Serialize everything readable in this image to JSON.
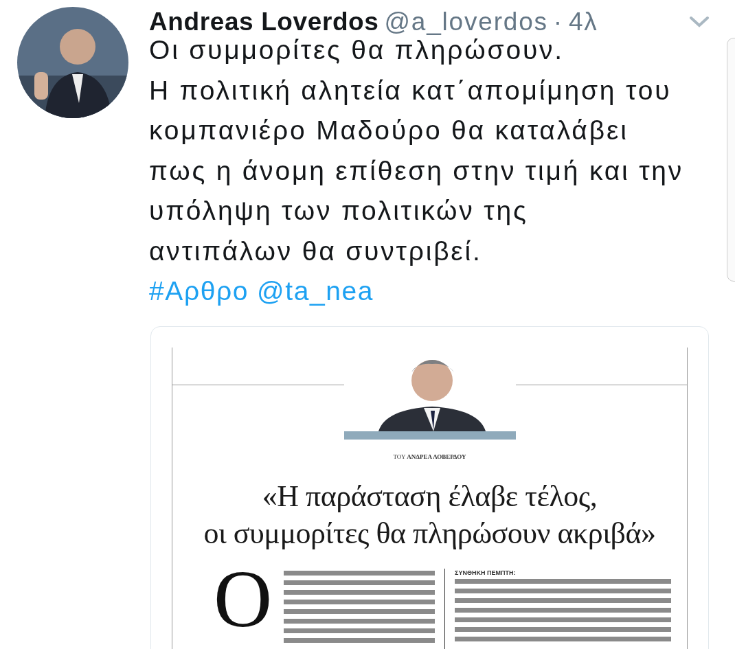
{
  "author": {
    "name": "Andreas Loverdos",
    "handle": "@a_loverdos",
    "separator": "·",
    "time": "4λ"
  },
  "tweet": {
    "text": "Οι συμμορίτες θα πληρώσουν.\nΗ πολιτική αλητεία κατ΄απομίμηση του\nκομπανιέρο Μαδούρο θα καταλάβει\nπως η άνομη επίθεση στην τιμή και την\nυπόληψη των πολιτικών της\nαντιπάλων θα συντριβεί.",
    "links": [
      {
        "text": "#Αρθρο"
      },
      {
        "text": "@ta_nea"
      }
    ]
  },
  "attachment": {
    "byline": "ΤΟΥ **ΑΝΔΡΕΑ ΛΟΒΕΡΔΟΥ**",
    "headline": "«Η παράσταση έλαβε τέλος,\nοι συμμορίτες θα πληρώσουν ακριβά»",
    "drop_cap": "Ο",
    "column_2_lead": "ΣΥΝΘΗΚΗ ΠΕΜΠΤΗ:"
  }
}
